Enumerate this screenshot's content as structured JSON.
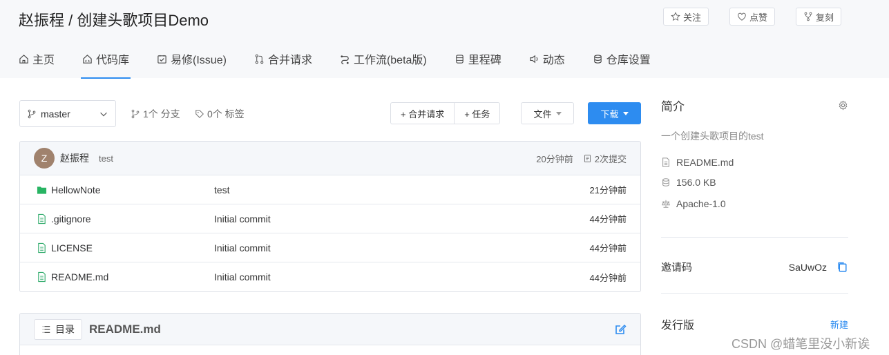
{
  "header": {
    "title": "赵振程 / 创建头歌项目Demo",
    "watch_label": "关注",
    "star_label": "点赞",
    "fork_label": "复刻"
  },
  "nav": [
    {
      "label": "主页",
      "icon": "home-icon"
    },
    {
      "label": "代码库",
      "icon": "code-icon",
      "active": true
    },
    {
      "label": "易修(Issue)",
      "icon": "issue-icon"
    },
    {
      "label": "合并请求",
      "icon": "merge-icon"
    },
    {
      "label": "工作流(beta版)",
      "icon": "workflow-icon"
    },
    {
      "label": "里程碑",
      "icon": "milestone-icon"
    },
    {
      "label": "动态",
      "icon": "activity-icon"
    },
    {
      "label": "仓库设置",
      "icon": "settings-icon"
    }
  ],
  "toolbar": {
    "branch": "master",
    "branch_count": "1个 分支",
    "tag_count": "0个 标签",
    "merge_request_label": "+ 合并请求",
    "task_label": "+ 任务",
    "file_label": "文件",
    "download_label": "下载"
  },
  "commit": {
    "avatar_letter": "Z",
    "author": "赵振程",
    "message": "test",
    "time": "20分钟前",
    "commit_count": "2次提交"
  },
  "files": [
    {
      "name": "HellowNote",
      "type": "folder",
      "commit": "test",
      "time": "21分钟前"
    },
    {
      "name": ".gitignore",
      "type": "file",
      "commit": "Initial commit",
      "time": "44分钟前"
    },
    {
      "name": "LICENSE",
      "type": "file",
      "commit": "Initial commit",
      "time": "44分钟前"
    },
    {
      "name": "README.md",
      "type": "file",
      "commit": "Initial commit",
      "time": "44分钟前"
    }
  ],
  "readme": {
    "toc_label": "目录",
    "title": "README.md"
  },
  "sidebar": {
    "intro_title": "简介",
    "description": "一个创建头歌项目的test",
    "readme": "README.md",
    "size": "156.0 KB",
    "license": "Apache-1.0",
    "invite_label": "邀请码",
    "invite_code": "SaUwOz",
    "release_label": "发行版",
    "new_label": "新建"
  },
  "watermark": "CSDN @蜡笔里没小新诶",
  "colors": {
    "accent": "#2d8cf0",
    "folder": "#28b463",
    "file": "#2eaa6a"
  }
}
